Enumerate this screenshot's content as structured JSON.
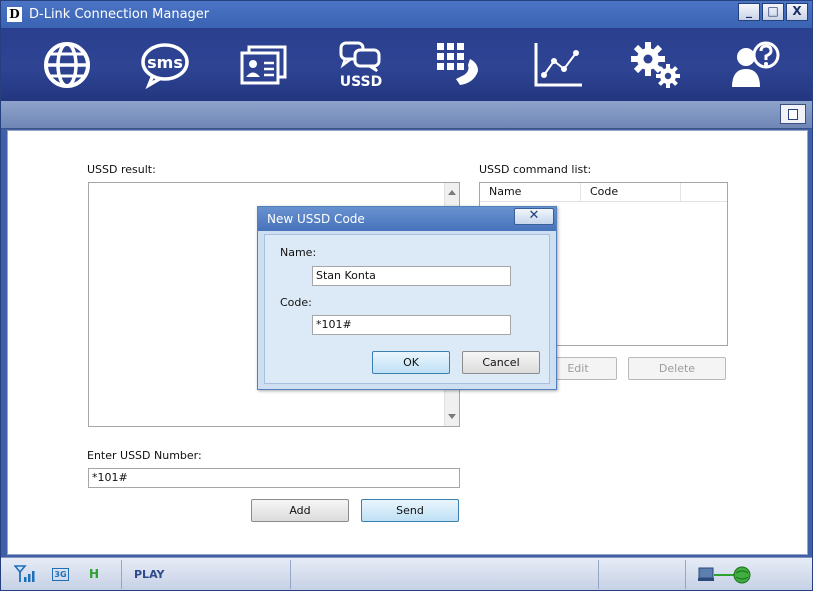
{
  "window": {
    "title": "D-Link Connection Manager",
    "logo": "D",
    "minimize": "_",
    "maximize": "□",
    "close": "X"
  },
  "toolbar": {
    "icons": [
      "internet-globe-icon",
      "sms-icon",
      "contacts-icon",
      "ussd-icon",
      "phone-dialer-icon",
      "statistics-chart-icon",
      "settings-gears-icon",
      "help-icon"
    ],
    "sms_label": "sms",
    "ussd_label": "USSD"
  },
  "main": {
    "ussd_result_label": "USSD result:",
    "command_list_label": "USSD command list:",
    "command_list_columns": [
      "Name",
      "Code"
    ],
    "enter_label": "Enter USSD Number:",
    "enter_value": "*101#",
    "add_button": "Add",
    "send_button": "Send",
    "edit_button": "Edit",
    "delete_button": "Delete"
  },
  "dialog": {
    "title": "New USSD Code",
    "close": "✕",
    "name_label": "Name:",
    "name_value": "Stan Konta",
    "code_label": "Code:",
    "code_value": "*101#",
    "ok_button": "OK",
    "cancel_button": "Cancel"
  },
  "statusbar": {
    "network_type": "3G",
    "h_badge": "H",
    "operator": "PLAY"
  },
  "colors": {
    "toolbar_bg": "#2b3f8f",
    "titlebar": "#3b63b3",
    "accent": "#2f4a8a",
    "status_green": "#2ea12e"
  }
}
